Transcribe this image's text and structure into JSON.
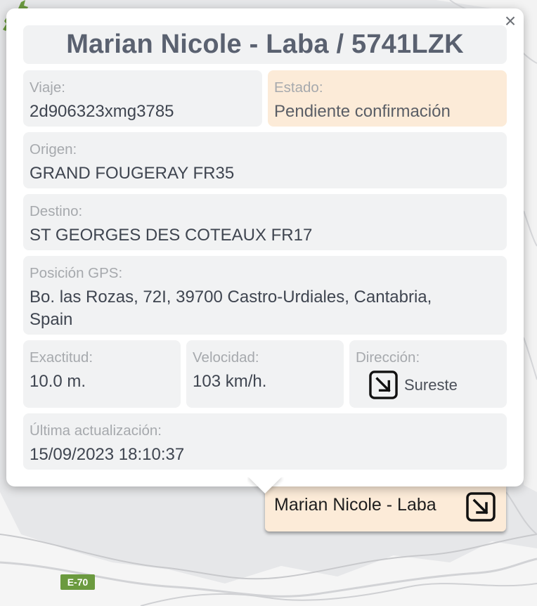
{
  "popup": {
    "title": "Marian Nicole - Laba / 5741LZK",
    "close_symbol": "×",
    "trip": {
      "label": "Viaje:",
      "value": "2d906323xmg3785"
    },
    "status": {
      "label": "Estado:",
      "value": "Pendiente confirmación",
      "color": "#fcebd8"
    },
    "origin": {
      "label": "Origen:",
      "value": "GRAND FOUGERAY FR35"
    },
    "destination": {
      "label": "Destino:",
      "value": "ST GEORGES DES COTEAUX FR17"
    },
    "gps": {
      "label": "Posición GPS:",
      "value": "Bo. las Rozas, 72I, 39700 Castro-Urdiales, Cantabria, Spain"
    },
    "accuracy": {
      "label": "Exactitud:",
      "value": "10.0 m."
    },
    "speed": {
      "label": "Velocidad:",
      "value": "103 km/h."
    },
    "direction": {
      "label": "Dirección:",
      "value": "Sureste",
      "icon": "arrow-down-right-icon"
    },
    "last_update": {
      "label": "Última actualización:",
      "value": "15/09/2023 18:10:37"
    }
  },
  "vehicle_label": {
    "name": "Marian Nicole - Laba",
    "icon": "arrow-down-right-icon",
    "color": "#fcebd8"
  },
  "map": {
    "road_badge": "E-70",
    "road_badge_color": "#6b9a3f",
    "marker_icon": "goat-marker-icon",
    "marker_color": "#6b9a3f"
  }
}
